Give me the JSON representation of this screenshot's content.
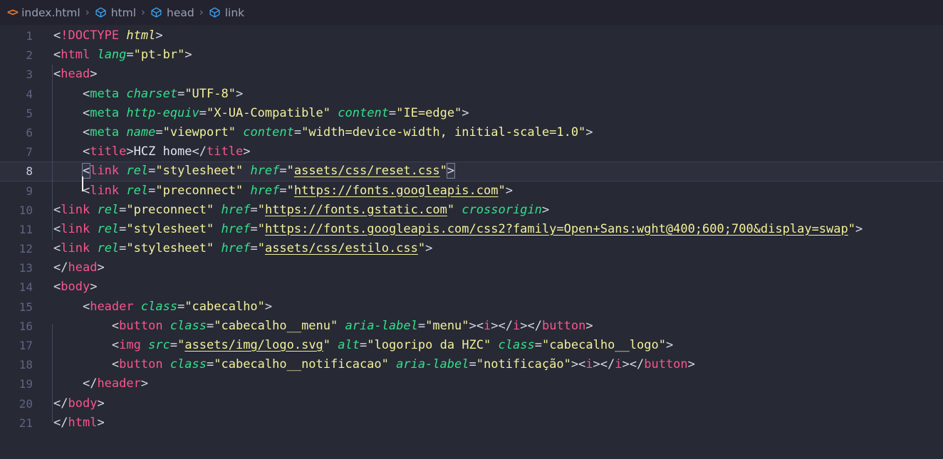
{
  "breadcrumb": {
    "items": [
      {
        "label": "index.html",
        "icon": "html-file-icon"
      },
      {
        "label": "html",
        "icon": "symbol-cube-icon"
      },
      {
        "label": "head",
        "icon": "symbol-cube-icon"
      },
      {
        "label": "link",
        "icon": "symbol-cube-icon"
      }
    ],
    "separator": "›"
  },
  "editor": {
    "active_line": 8,
    "total_lines": 21,
    "language": "html",
    "colors": {
      "background": "#272935",
      "breadcrumb_background": "#22232e",
      "active_line": "#2d2f3d",
      "line_number": "#5e6580",
      "line_number_active": "#c8cce0",
      "tag_pink": "#f9558b",
      "tag_green": "#33e08a",
      "attribute": "#33e08a",
      "string": "#f3f19a",
      "punctuation": "#d8dae6",
      "html_icon": "#e8752c",
      "cube_icon": "#3ba0f0",
      "indent_guide": "#454a60"
    },
    "lines": [
      {
        "n": 1,
        "text": "<!DOCTYPE html>"
      },
      {
        "n": 2,
        "text": "<html lang=\"pt-br\">"
      },
      {
        "n": 3,
        "text": "<head>"
      },
      {
        "n": 4,
        "text": "    <meta charset=\"UTF-8\">"
      },
      {
        "n": 5,
        "text": "    <meta http-equiv=\"X-UA-Compatible\" content=\"IE=edge\">"
      },
      {
        "n": 6,
        "text": "    <meta name=\"viewport\" content=\"width=device-width, initial-scale=1.0\">"
      },
      {
        "n": 7,
        "text": "    <title>HCZ home</title>"
      },
      {
        "n": 8,
        "text": "    <link rel=\"stylesheet\" href=\"assets/css/reset.css\">"
      },
      {
        "n": 9,
        "text": "    <link rel=\"preconnect\" href=\"https://fonts.googleapis.com\">"
      },
      {
        "n": 10,
        "text": "<link rel=\"preconnect\" href=\"https://fonts.gstatic.com\" crossorigin>"
      },
      {
        "n": 11,
        "text": "<link rel=\"stylesheet\" href=\"https://fonts.googleapis.com/css2?family=Open+Sans:wght@400;600;700&display=swap\">"
      },
      {
        "n": 12,
        "text": "<link rel=\"stylesheet\" href=\"assets/css/estilo.css\">"
      },
      {
        "n": 13,
        "text": "</head>"
      },
      {
        "n": 14,
        "text": "<body>"
      },
      {
        "n": 15,
        "text": "    <header class=\"cabecalho\">"
      },
      {
        "n": 16,
        "text": "        <button class=\"cabecalho__menu\" aria-label=\"menu\"><i></i></button>"
      },
      {
        "n": 17,
        "text": "        <img src=\"assets/img/logo.svg\" alt=\"logoripo da HZC\" class=\"cabecalho__logo\">"
      },
      {
        "n": 18,
        "text": "        <button class=\"cabecalho__notificacao\" aria-label=\"notificação\"><i></i></button>"
      },
      {
        "n": 19,
        "text": "    </header>"
      },
      {
        "n": 20,
        "text": "</body>"
      },
      {
        "n": 21,
        "text": "</html>"
      }
    ],
    "tokens": {
      "l1": {
        "lt": "<",
        "doctype": "!DOCTYPE",
        "name": "html",
        "gt": ">"
      },
      "l2": {
        "tag": "html",
        "attr": "lang",
        "val": "\"pt-br\""
      },
      "l3": {
        "tag": "head"
      },
      "l4": {
        "tag": "meta",
        "attr": "charset",
        "val": "\"UTF-8\""
      },
      "l5": {
        "tag": "meta",
        "attr1": "http-equiv",
        "val1": "\"X-UA-Compatible\"",
        "attr2": "content",
        "val2": "\"IE=edge\""
      },
      "l6": {
        "tag": "meta",
        "attr1": "name",
        "val1": "\"viewport\"",
        "attr2": "content",
        "val2": "\"width=device-width, initial-scale=1.0\""
      },
      "l7": {
        "tag": "title",
        "text": "HCZ home"
      },
      "l8": {
        "tag": "link",
        "attr1": "rel",
        "val1": "\"stylesheet\"",
        "attr2": "href",
        "val2": "\"assets/css/reset.css\"",
        "link": "assets/css/reset.css"
      },
      "l9": {
        "tag": "link",
        "attr1": "rel",
        "val1": "\"preconnect\"",
        "attr2": "href",
        "val2": "\"https://fonts.googleapis.com\"",
        "link": "https://fonts.googleapis.com"
      },
      "l10": {
        "tag": "link",
        "attr1": "rel",
        "val1": "\"preconnect\"",
        "attr2": "href",
        "val2": "\"https://fonts.gstatic.com\"",
        "attr3": "crossorigin",
        "link": "https://fonts.gstatic.com"
      },
      "l11": {
        "tag": "link",
        "attr1": "rel",
        "val1": "\"stylesheet\"",
        "attr2": "href",
        "link": "https://fonts.googleapis.com/css2?family=Open+Sans:wght@400;600;700&display=swap"
      },
      "l12": {
        "tag": "link",
        "attr1": "rel",
        "val1": "\"stylesheet\"",
        "attr2": "href",
        "link": "assets/css/estilo.css"
      },
      "l13": {
        "tag": "head"
      },
      "l14": {
        "tag": "body"
      },
      "l15": {
        "tag": "header",
        "attr": "class",
        "val": "\"cabecalho\""
      },
      "l16": {
        "tag": "button",
        "attr1": "class",
        "val1": "\"cabecalho__menu\"",
        "attr2": "aria-label",
        "val2": "\"menu\"",
        "inner": "i"
      },
      "l17": {
        "tag": "img",
        "attr1": "src",
        "val1": "assets/img/logo.svg",
        "attr2": "alt",
        "val2": "\"logoripo da HZC\"",
        "attr3": "class",
        "val3": "\"cabecalho__logo\""
      },
      "l18": {
        "tag": "button",
        "attr1": "class",
        "val1": "\"cabecalho__notificacao\"",
        "attr2": "aria-label",
        "val2": "\"notificação\"",
        "inner": "i"
      },
      "l19": {
        "tag": "header"
      },
      "l20": {
        "tag": "body"
      },
      "l21": {
        "tag": "html"
      }
    }
  }
}
